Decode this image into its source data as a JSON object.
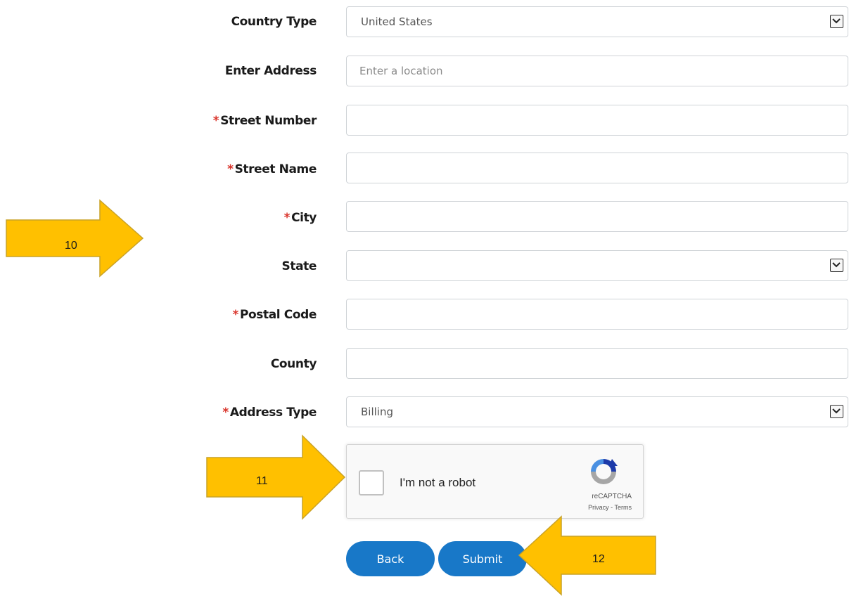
{
  "form": {
    "country_type": {
      "label": "Country Type",
      "value": "United States",
      "required": false
    },
    "enter_address": {
      "label": "Enter Address",
      "placeholder": "Enter a location",
      "required": false
    },
    "street_number": {
      "label": "Street Number",
      "required": true
    },
    "street_name": {
      "label": "Street Name",
      "required": true
    },
    "city": {
      "label": "City",
      "required": true
    },
    "state": {
      "label": "State",
      "value": "",
      "required": false
    },
    "postal_code": {
      "label": "Postal Code",
      "required": true
    },
    "county": {
      "label": "County",
      "required": false
    },
    "address_type": {
      "label": "Address Type",
      "value": "Billing",
      "required": true
    },
    "required_marker": "*"
  },
  "captcha": {
    "text": "I'm not a robot",
    "brand": "reCAPTCHA",
    "links": "Privacy - Terms"
  },
  "buttons": {
    "back_label": "Back",
    "submit_label": "Submit"
  },
  "annotations": {
    "arrow_10": "10",
    "arrow_11": "11",
    "arrow_12": "12"
  },
  "colors": {
    "button": "#1878c8",
    "required": "#d9342b",
    "arrow_fill": "#ffc000",
    "arrow_stroke": "#c9a227"
  }
}
